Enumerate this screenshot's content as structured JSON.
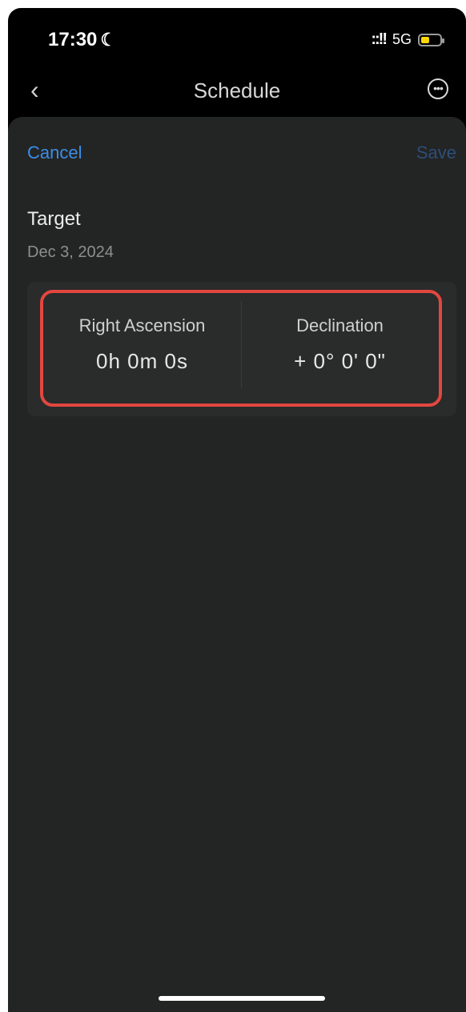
{
  "status_bar": {
    "time": "17:30",
    "moon_icon": "☾",
    "signal": "::!!",
    "network": "5G",
    "battery_color": "#ffd60a",
    "battery_level": 0.45
  },
  "navbar": {
    "back_icon": "‹",
    "title": "Schedule",
    "more_icon": "•••"
  },
  "sheet": {
    "cancel_label": "Cancel",
    "save_label": "Save",
    "target_label": "Target",
    "date": "Dec 3, 2024",
    "right_ascension": {
      "label": "Right Ascension",
      "value": "0h  0m  0s"
    },
    "declination": {
      "label": "Declination",
      "value": "+  0°  0'  0\""
    }
  },
  "colors": {
    "accent": "#3a8ee6",
    "highlight": "#e2473f"
  }
}
